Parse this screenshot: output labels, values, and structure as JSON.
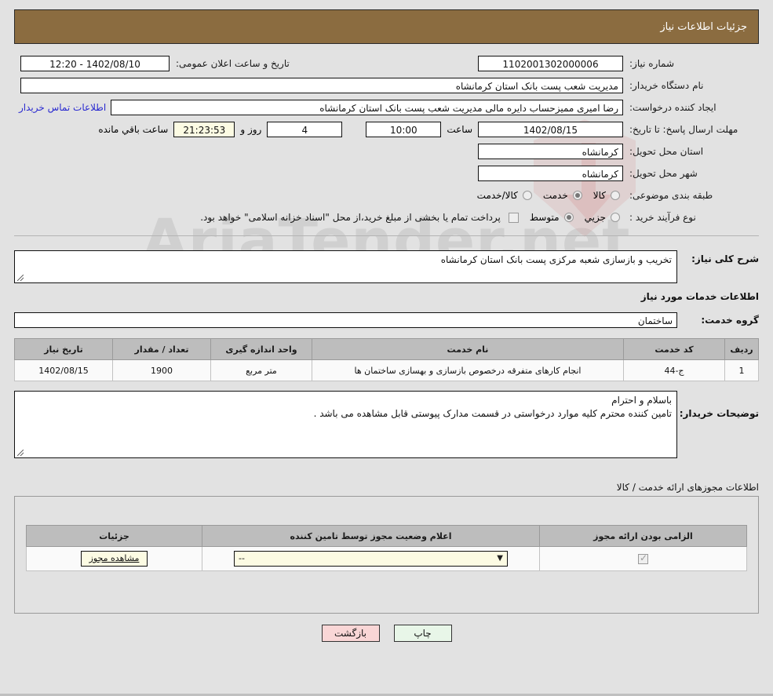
{
  "header": {
    "title": "جزئیات اطلاعات نیاز"
  },
  "info": {
    "need_number_label": "شماره نیاز:",
    "need_number_value": "1102001302000006",
    "announce_datetime_label": "تاریخ و ساعت اعلان عمومی:",
    "announce_datetime_value": "1402/08/10 - 12:20",
    "buyer_org_label": "نام دستگاه خریدار:",
    "buyer_org_value": "مدیریت شعب پست بانک استان کرمانشاه",
    "creator_label": "ایجاد کننده درخواست:",
    "creator_value": "رضا امیری ممیزحساب دایره مالی مدیریت شعب پست بانک استان کرمانشاه",
    "contact_link": "اطلاعات تماس خریدار",
    "deadline_label": "مهلت ارسال پاسخ: تا تاریخ:",
    "deadline_date": "1402/08/15",
    "time_label": "ساعت",
    "deadline_time": "10:00",
    "days_value": "4",
    "days_label": "روز و",
    "countdown_value": "21:23:53",
    "remaining_label": "ساعت باقي مانده",
    "province_label": "استان محل تحویل:",
    "province_value": "کرمانشاه",
    "city_label": "شهر محل تحویل:",
    "city_value": "کرمانشاه",
    "category_label": "طبقه بندی موضوعی:",
    "category_options": [
      {
        "label": "کالا",
        "selected": false
      },
      {
        "label": "خدمت",
        "selected": true
      },
      {
        "label": "کالا/خدمت",
        "selected": false
      }
    ],
    "process_label": "نوع فرآیند خرید :",
    "process_options": [
      {
        "label": "جزیي",
        "selected": false
      },
      {
        "label": "متوسط",
        "selected": true
      }
    ],
    "payment_checkbox_checked": false,
    "payment_note": "پرداخت تمام یا بخشی از مبلغ خرید،از محل \"اسناد خزانه اسلامی\" خواهد بود."
  },
  "description": {
    "overall_label": "شرح کلی نیاز:",
    "overall_value": "تخریب و بازسازی شعبه مرکزی پست بانک استان کرمانشاه",
    "services_heading": "اطلاعات خدمات مورد نیاز",
    "service_group_label": "گروه خدمت:",
    "service_group_value": "ساختمان"
  },
  "service_table": {
    "columns": [
      "ردیف",
      "کد خدمت",
      "نام خدمت",
      "واحد اندازه گیری",
      "تعداد / مقدار",
      "تاریخ نیاز"
    ],
    "rows": [
      {
        "row": "1",
        "code": "ج-44",
        "name": "انجام کارهای متفرقه درخصوص بازسازی و بهسازی ساختمان ها",
        "unit": "متر مربع",
        "quantity": "1900",
        "date": "1402/08/15"
      }
    ]
  },
  "buyer_notes": {
    "label": "توضیحات خریدار:",
    "line1": "باسلام و احترام",
    "line2": "تامین کننده محترم کلیه موارد درخواستی در قسمت مدارک پیوستی قابل مشاهده می باشد ."
  },
  "permits": {
    "section_label": "اطلاعات مجوزهای ارائه خدمت / کالا",
    "columns": [
      "الزامی بودن ارائه مجوز",
      "اعلام وضعیت مجوز توسط تامین کننده",
      "جزئیات"
    ],
    "rows": [
      {
        "required_checked": true,
        "status_value": "--",
        "details_button": "مشاهده مجوز"
      }
    ]
  },
  "footer": {
    "print_label": "چاپ",
    "back_label": "بازگشت"
  },
  "watermark": {
    "text": "AriaTender.net"
  },
  "colors": {
    "header_bg": "#8b6c40",
    "page_bg": "#e2e2e2",
    "link": "#2a2ad0",
    "print_btn": "#e8f6e8",
    "back_btn": "#f9d6d6",
    "highlight_field": "#fcfbe3"
  }
}
